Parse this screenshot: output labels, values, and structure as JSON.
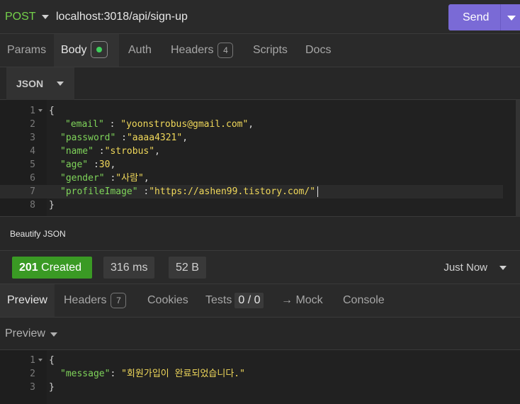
{
  "request": {
    "method": "POST",
    "url": "localhost:3018/api/sign-up",
    "send_label": "Send"
  },
  "request_tabs": {
    "params": "Params",
    "body": "Body",
    "auth": "Auth",
    "headers": "Headers",
    "headers_count": "4",
    "scripts": "Scripts",
    "docs": "Docs"
  },
  "body_format": "JSON",
  "editor": {
    "lines": [
      {
        "n": "1",
        "text": "{"
      },
      {
        "n": "2",
        "key": "\"email\"",
        "sep": " : ",
        "value": "\"yoonstrobus@gmail.com\"",
        "tail": ","
      },
      {
        "n": "3",
        "key": "\"password\"",
        "sep": " :",
        "value": "\"aaaa4321\"",
        "tail": ","
      },
      {
        "n": "4",
        "key": "\"name\"",
        "sep": " :",
        "value": "\"strobus\"",
        "tail": ","
      },
      {
        "n": "5",
        "key": "\"age\"",
        "sep": " :",
        "value": "30",
        "tail": ","
      },
      {
        "n": "6",
        "key": "\"gender\"",
        "sep": " :",
        "value": "\"사람\"",
        "tail": ","
      },
      {
        "n": "7",
        "key": "\"profileImage\"",
        "sep": " :",
        "value": "\"https://ashen99.tistory.com/\"",
        "tail": ""
      },
      {
        "n": "8",
        "text": "}"
      }
    ]
  },
  "beautify_label": "Beautify JSON",
  "response": {
    "status_code": "201",
    "status_text": "Created",
    "time": "316 ms",
    "size": "52 B",
    "timestamp": "Just Now"
  },
  "response_tabs": {
    "preview": "Preview",
    "headers": "Headers",
    "headers_count": "7",
    "cookies": "Cookies",
    "tests": "Tests",
    "tests_count": "0 / 0",
    "mock": "→ Mock",
    "console": "Console"
  },
  "preview_mode": "Preview",
  "result": {
    "lines": [
      {
        "n": "1",
        "text": "{"
      },
      {
        "n": "2",
        "key": "\"message\"",
        "sep": ": ",
        "value": "\"회원가입이 완료되었습니다.\""
      },
      {
        "n": "3",
        "text": "}"
      }
    ]
  },
  "colors": {
    "accent": "#7a6ad6",
    "success": "#3a9a24",
    "method": "#74d14a",
    "json_key": "#7fd45a",
    "json_string": "#f0d85a"
  }
}
